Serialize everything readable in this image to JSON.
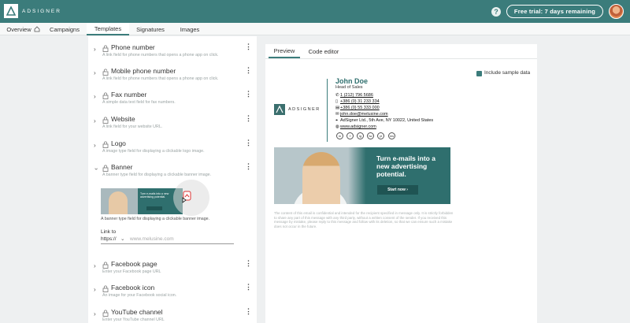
{
  "app": {
    "brand": "ADSIGNER",
    "trial_label": "Free trial: 7 days remaining",
    "help": "?"
  },
  "nav": [
    {
      "label": "Overview"
    },
    {
      "label": "Campaigns"
    },
    {
      "label": "Templates"
    },
    {
      "label": "Signatures"
    },
    {
      "label": "Images"
    }
  ],
  "fields": [
    {
      "title": "Phone number",
      "desc": "A link field for phone numbers that opens a phone app on click."
    },
    {
      "title": "Mobile phone number",
      "desc": "A link field for phone numbers that opens a phone app on click."
    },
    {
      "title": "Fax number",
      "desc": "A simple data text field for fax numbers."
    },
    {
      "title": "Website",
      "desc": "A link field for your website URL."
    },
    {
      "title": "Logo",
      "desc": "A image type field for displaying a clickable logo image."
    },
    {
      "title": "Banner",
      "desc": "A banner type field for displaying a clickable banner image."
    },
    {
      "title": "Facebook page",
      "desc": "Enter your Facebook page URL"
    },
    {
      "title": "Facebook icon",
      "desc": "An image for your Facebook social icon."
    },
    {
      "title": "YouTube channel",
      "desc": "Enter your YouTube channel URL"
    }
  ],
  "banner_editor": {
    "thumb_text": "Turn e-mails into a new advertising potential.",
    "caption": "A banner type field for displaying a clickable banner image.",
    "link_label": "Link to",
    "protocol": "https://",
    "url_placeholder": "www.melusine.com"
  },
  "preview": {
    "tabs": [
      "Preview",
      "Code editor"
    ],
    "include_sample_label": "Include sample data",
    "include_sample_checked": true,
    "signature": {
      "logo_text": "ADSIGNER",
      "name": "John Doe",
      "role": "Head of Sales",
      "phone": "1 (212) 796 5686",
      "mobile": "+386 (0) 31 233 334",
      "fax": "+386 (0) 55 333 000",
      "email": "john.doe@melusine.com",
      "address": "AdSigner Ltd.,  5th Ave, NY 10022, United States",
      "website": "www.adsigner.com",
      "socials": [
        "in",
        "f",
        "ig",
        "tw",
        "yt",
        "ms"
      ]
    },
    "banner": {
      "headline": "Turn e-mails into a new advertising potential.",
      "cta": "Start now ›"
    },
    "disclaimer": "The content of this email is confidential and intended for the recipient specified in message only. It is strictly forbidden to share any part of this message with any third party, without a written consent of the sender. If you received this message by mistake, please reply to this message and follow with its deletion, so that we can ensure such a mistake does not occur in the future."
  },
  "colors": {
    "brand": "#3b7c7b",
    "accent_dark": "#1f5453"
  }
}
